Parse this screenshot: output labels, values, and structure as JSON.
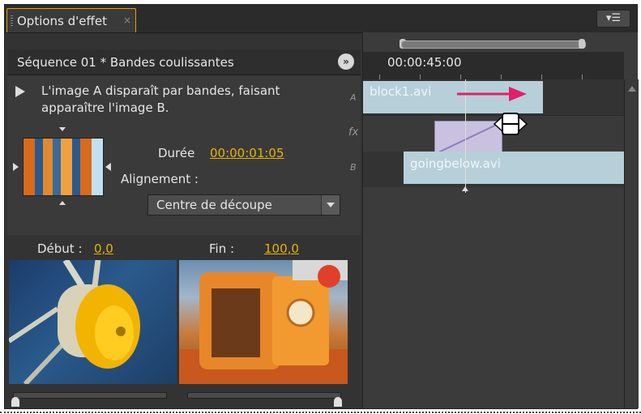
{
  "panel": {
    "tab_label": "Options d'effet",
    "tab_close": "×",
    "menu_icon": "menu-icon"
  },
  "sequence": {
    "title": "Séquence 01 * Bandes coulissantes",
    "nav_button": "»"
  },
  "effect": {
    "description": "L'image A disparaît par bandes, faisant apparaître l'image B.",
    "duration_label": "Durée",
    "duration_value": "00:00:01:05",
    "alignment_label": "Alignement :",
    "alignment_selected": "Centre de découpe"
  },
  "previews": {
    "start_label": "Début :",
    "start_value": "0,0",
    "end_label": "Fin :",
    "end_value": "100,0",
    "start_slider_fraction": 0.0,
    "end_slider_fraction": 1.0
  },
  "timeline": {
    "timecode": "00:00:45:00",
    "track_a_letter": "A",
    "track_fx_letter": "fx",
    "track_b_letter": "B",
    "clip_a_name": "block1.avi",
    "clip_b_name": "goingbelow.avi"
  },
  "colors": {
    "accent": "#e8a000",
    "value_yellow": "#e8b400",
    "clip_blue": "#b7cfd9",
    "transition_purple": "#c9c1e0",
    "arrow_magenta": "#e0206a"
  }
}
